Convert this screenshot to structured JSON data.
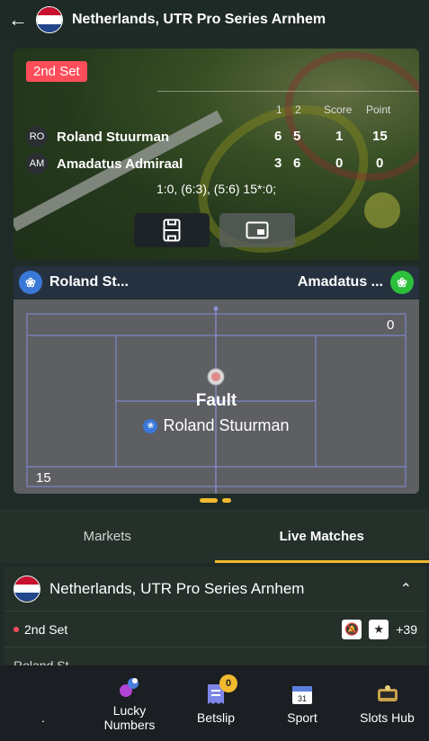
{
  "header": {
    "back_icon": "arrow-left-icon",
    "title": "Netherlands, UTR Pro Series Arnhem"
  },
  "scoreboard": {
    "set_badge": "2nd Set",
    "columns": [
      "1",
      "2",
      "Score",
      "Point"
    ],
    "players": [
      {
        "initials": "RO",
        "name": "Roland Stuurman",
        "set1": "6",
        "set2": "5",
        "score": "1",
        "point": "15"
      },
      {
        "initials": "AM",
        "name": "Amadatus Admiraal",
        "set1": "3",
        "set2": "6",
        "score": "0",
        "point": "0"
      }
    ],
    "summary": "1:0, (6:3), (5:6) 15*:0;",
    "buttons": [
      {
        "icon": "field-view-icon"
      },
      {
        "icon": "picture-in-picture-icon"
      }
    ]
  },
  "visualization": {
    "home_team": "Roland St...",
    "away_team": "Amadatus ...",
    "court_scores": {
      "top_right": "0",
      "bottom_left": "15"
    },
    "event_title": "Fault",
    "event_player": "Roland Stuurman"
  },
  "tabs": [
    {
      "label": "Markets",
      "active": false
    },
    {
      "label": "Live Matches",
      "active": true
    }
  ],
  "match_panel": {
    "title": "Netherlands, UTR Pro Series Arnhem",
    "set_label": "2nd Set",
    "more_count": "+39",
    "next_row_text": "Roland St..."
  },
  "bottom_nav": [
    {
      "label": ".",
      "icon": ""
    },
    {
      "label": "Lucky Numbers",
      "icon": "lottery-balls-icon"
    },
    {
      "label": "Betslip",
      "icon": "betslip-icon",
      "badge": "0"
    },
    {
      "label": "Sport",
      "icon": "calendar-icon",
      "icon_text": "31"
    },
    {
      "label": "Slots Hub",
      "icon": "slots-icon"
    }
  ],
  "colors": {
    "accent": "#f0b92e",
    "live_red": "#ff4d5a",
    "bg": "#1f2b26"
  }
}
